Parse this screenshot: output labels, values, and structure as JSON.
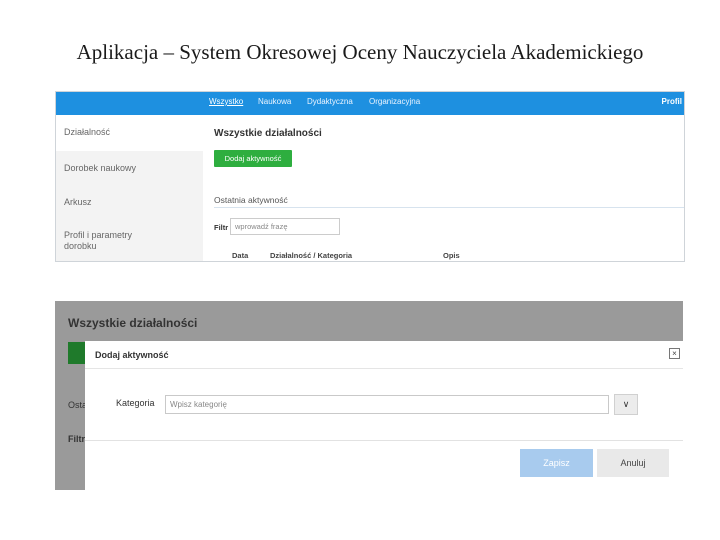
{
  "slide": {
    "title": "Aplikacja – System Okresowej Oceny Nauczyciela Akademickiego"
  },
  "screen1": {
    "nav_tabs": [
      "Wszystko",
      "Naukowa",
      "Dydaktyczna",
      "Organizacyjna"
    ],
    "active_tab": "Wszystko",
    "profile_label": "Profil",
    "sidebar": [
      "Działalność",
      "Dorobek naukowy",
      "Arkusz",
      "Profil i parametry",
      "dorobku"
    ],
    "heading": "Wszystkie działalności",
    "add_button": "Dodaj aktywność",
    "recent_label": "Ostatnia aktywność",
    "filter_label": "Filtr",
    "filter_placeholder": "wprowadź frazę",
    "columns": [
      "Data",
      "Działalność / Kategoria",
      "Opis"
    ]
  },
  "screen2": {
    "background": {
      "heading": "Wszystkie działalności",
      "partial_recent": "Osta",
      "partial_filter": "Filtr"
    },
    "modal": {
      "title": "Dodaj aktywność",
      "close_glyph": "×",
      "category_label": "Kategoria",
      "category_placeholder": "Wpisz kategorię",
      "dropdown_glyph": "∨",
      "save_button": "Zapisz",
      "cancel_button": "Anuluj"
    }
  },
  "colors": {
    "topbar": "#1e90e0",
    "add_button": "#2eae3f",
    "save_button": "#a8cbee",
    "overlay": "#9a9a9a"
  }
}
